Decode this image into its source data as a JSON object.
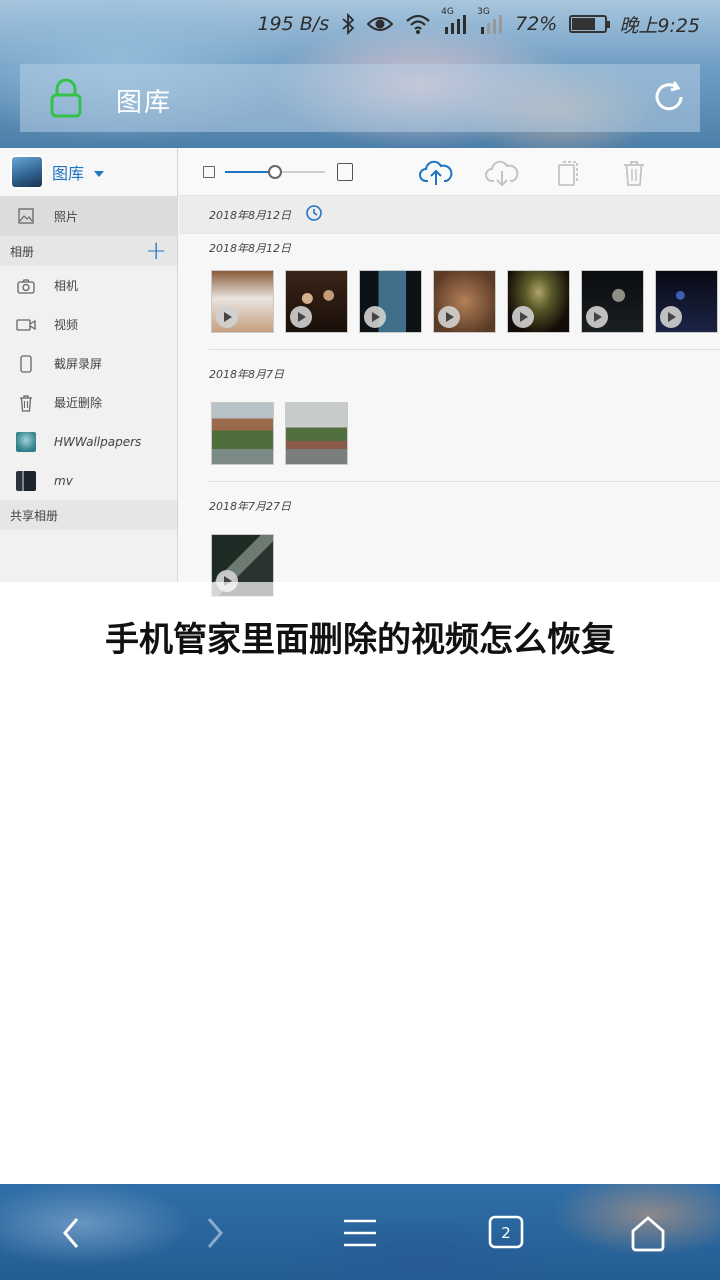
{
  "status_bar": {
    "speed": "195 B/s",
    "network_4g": "4G",
    "network_3g": "3G",
    "battery_percent": "72%",
    "battery_level": 0.72,
    "time": "晚上9:25"
  },
  "header": {
    "title": "图库"
  },
  "sidebar": {
    "account_label": "图库",
    "items": [
      {
        "label": "照片",
        "icon": "image-icon",
        "selected": true
      }
    ],
    "albums_section": "相册",
    "albums": [
      {
        "label": "相机",
        "icon": "camera-icon"
      },
      {
        "label": "视频",
        "icon": "video-icon"
      },
      {
        "label": "截屏录屏",
        "icon": "phone-icon"
      },
      {
        "label": "最近删除",
        "icon": "trash-icon"
      },
      {
        "label": "HWWallpapers",
        "icon": "album-thumb"
      },
      {
        "label": "mv",
        "icon": "album-thumb"
      }
    ],
    "shared_section": "共享相册"
  },
  "toolbar": {
    "zoom_level": 0.5,
    "buttons": [
      "upload-cloud-icon",
      "download-cloud-icon",
      "copy-icon",
      "delete-icon"
    ]
  },
  "gallery": {
    "sticky_date": "2018年8月12日",
    "groups": [
      {
        "date": "2018年8月12日",
        "count": 7,
        "videos": true
      },
      {
        "date": "2018年8月7日",
        "count": 2,
        "videos": false
      },
      {
        "date": "2018年7月27日",
        "count": 1,
        "videos": true
      }
    ]
  },
  "caption": "手机管家里面删除的视频怎么恢复",
  "bottom_nav": {
    "tabs_count": "2"
  },
  "colors": {
    "accent": "#1f74c4",
    "lock_green": "#35c24a"
  }
}
